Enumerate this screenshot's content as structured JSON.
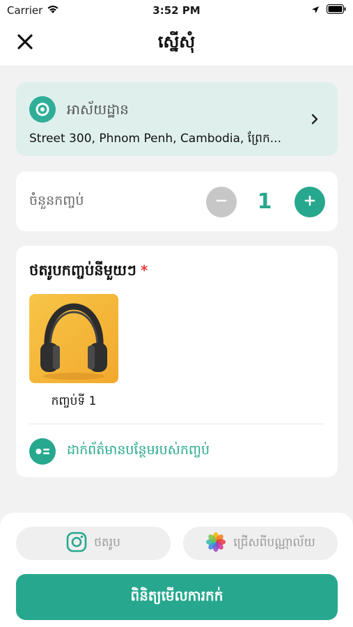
{
  "status_bar": {
    "carrier": "Carrier",
    "time": "3:52 PM"
  },
  "nav": {
    "title": "ស្នើសុំ"
  },
  "address": {
    "label": "អាស័យដ្ឋាន",
    "value": "Street 300, Phnom Penh, Cambodia, ព្រែក..."
  },
  "quantity": {
    "label": "ចំនួនកញ្ចប់",
    "value": "1"
  },
  "photos": {
    "title": "ថតរូបកញ្ចប់នីមួយៗ",
    "required_mark": "*",
    "items": [
      {
        "caption": "កញ្ចប់ទី 1",
        "image": "headphones-photo"
      }
    ],
    "more_info_label": "ដាក់ព័ត៌មានបន្ថែមរបស់កញ្ចប់"
  },
  "bottom": {
    "camera_label": "ថតរូប",
    "gallery_label": "ជ្រើសពីបណ្ណាល័យ",
    "submit_label": "ពិនិត្យមើលការកក់"
  },
  "colors": {
    "accent": "#27a88e",
    "address_bg": "#dff0ec",
    "minus_bg": "#c7c7c7",
    "required": "#e03b3b"
  }
}
